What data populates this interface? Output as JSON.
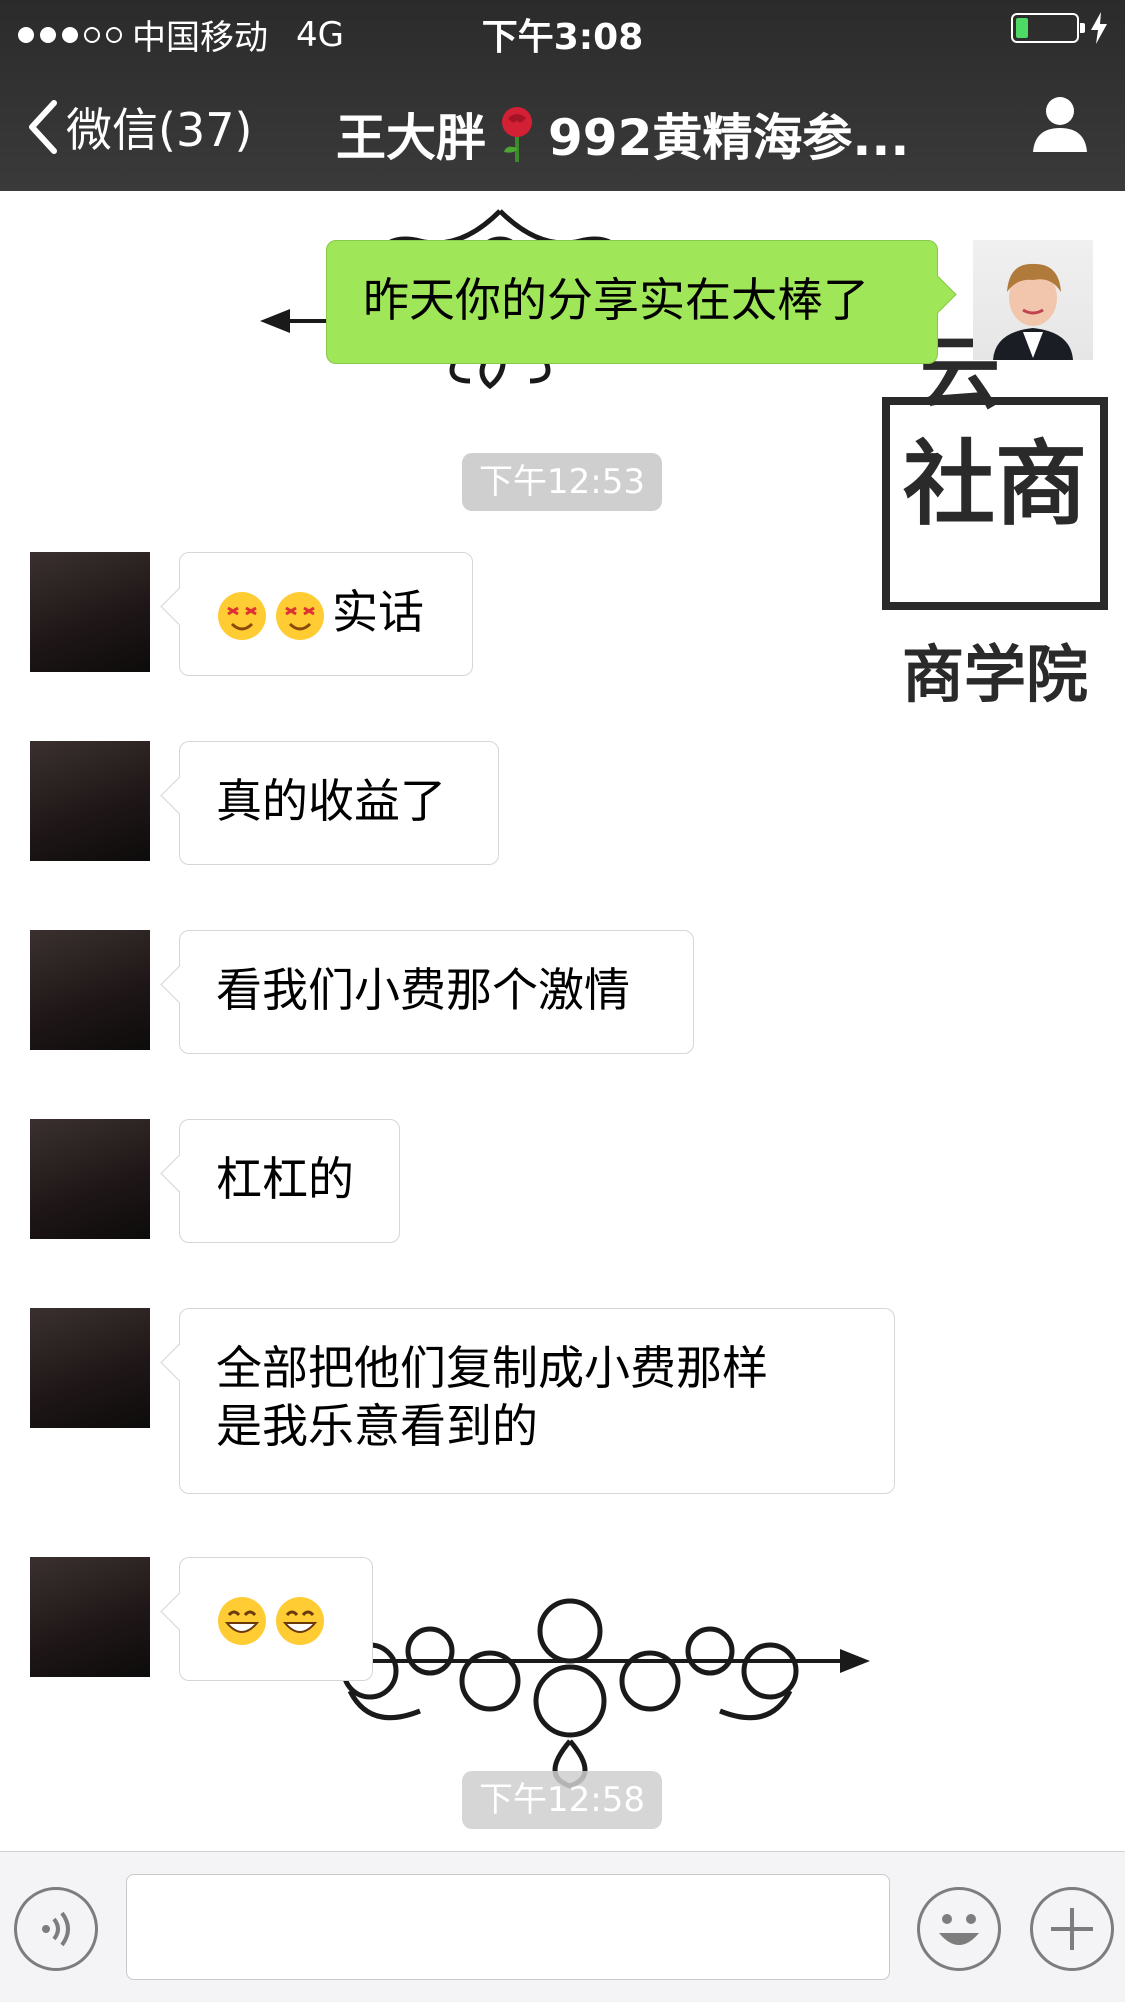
{
  "status_bar": {
    "signal_dots_filled": 3,
    "signal_dots_total": 5,
    "carrier": "中国移动",
    "network": "4G",
    "time": "下午3:08",
    "battery_level": 0.2
  },
  "nav": {
    "back_label": "微信(37)",
    "title_name": "王大胖",
    "title_group": "992黄精海参..."
  },
  "timestamps": [
    "下午12:53",
    "下午12:58"
  ],
  "messages": [
    {
      "side": "out",
      "text": "昨天你的分享实在太棒了"
    },
    {
      "side": "in",
      "text": "实话",
      "emoji_prefix": [
        "dizzy-face-emoji",
        "dizzy-face-emoji"
      ]
    },
    {
      "side": "in",
      "text": "真的收益了"
    },
    {
      "side": "in",
      "text": "看我们小费那个激情"
    },
    {
      "side": "in",
      "text": "杠杠的"
    },
    {
      "side": "in",
      "text_lines": [
        "全部把他们复制成小费那样",
        "是我乐意看到的"
      ]
    },
    {
      "side": "in",
      "emoji_only": [
        "grinning-face-emoji",
        "grinning-face-emoji"
      ]
    }
  ],
  "watermark": {
    "text_top": "云",
    "text_logo": "社商",
    "text_sub": "商学院"
  },
  "colors": {
    "header_bg": "#333333",
    "outgoing_bubble": "#9fe658",
    "incoming_bubble": "#ffffff",
    "timestamp_bg": "#cfcfcf"
  }
}
